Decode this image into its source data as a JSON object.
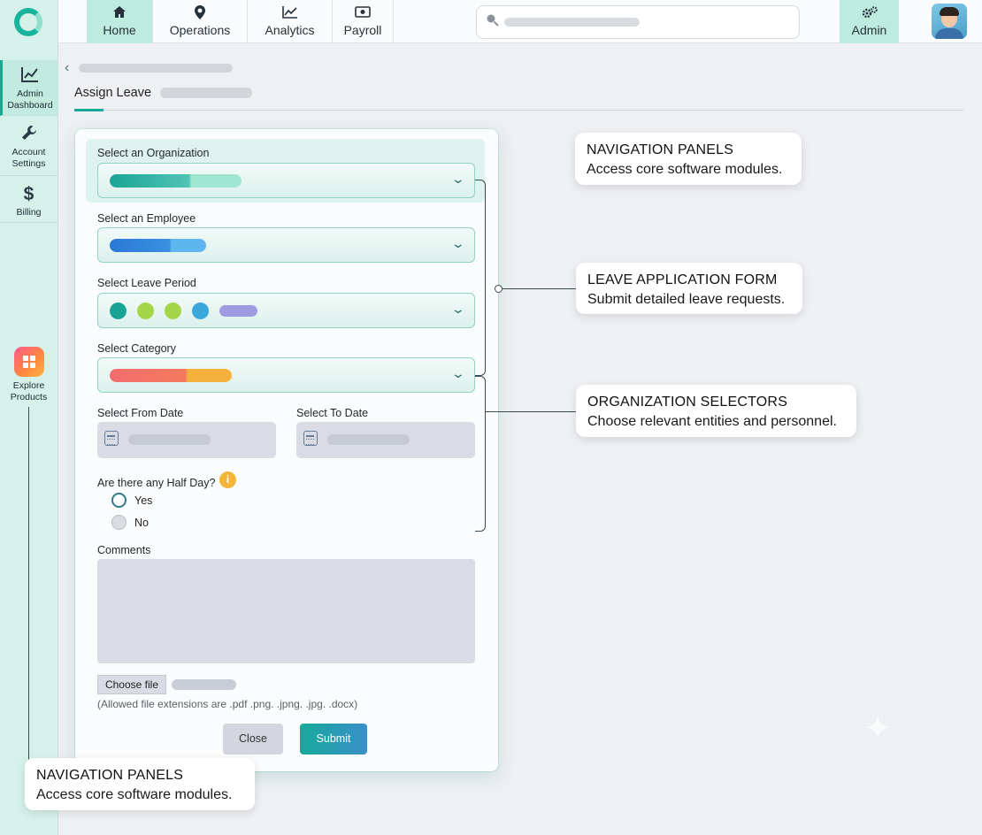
{
  "sidebar": {
    "items": [
      {
        "label1": "Admin",
        "label2": "Dashboard",
        "icon": "chart-line-icon"
      },
      {
        "label1": "Account",
        "label2": "Settings",
        "icon": "wrench-icon"
      },
      {
        "label1": "Billing",
        "label2": "",
        "icon": "dollar-icon"
      }
    ],
    "explore": {
      "label1": "Explore",
      "label2": "Products",
      "icon": "grid-apps-icon"
    }
  },
  "topnav": {
    "tabs": [
      {
        "label": "Home",
        "icon": "home-icon"
      },
      {
        "label": "Operations",
        "icon": "location-pin-icon"
      },
      {
        "label": "Analytics",
        "icon": "chart-line-icon"
      },
      {
        "label": "Payroll",
        "icon": "banknote-icon"
      }
    ],
    "admin_label": "Admin",
    "admin_icon": "gears-icon"
  },
  "header": {
    "title": "Assign Leave"
  },
  "form": {
    "organization_label": "Select an Organization",
    "employee_label": "Select an Employee",
    "period_label": "Select Leave Period",
    "category_label": "Select Category",
    "from_date_label": "Select From Date",
    "to_date_label": "Select To Date",
    "half_day_label": "Are there any Half Day?",
    "half_day_options": [
      "Yes",
      "No"
    ],
    "comments_label": "Comments",
    "choose_file_label": "Choose file",
    "file_hint": "(Allowed file extensions are .pdf  .png. .jpng. .jpg. .docx)",
    "close_label": "Close",
    "submit_label": "Submit"
  },
  "callouts": {
    "nav_top": {
      "title": "NAVIGATION PANELS",
      "desc": "Access core software modules."
    },
    "leave_form": {
      "title": "LEAVE APPLICATION FORM",
      "desc": "Submit detailed leave requests."
    },
    "org_selectors": {
      "title": "ORGANIZATION SELECTORS",
      "desc": "Choose relevant entities and personnel."
    },
    "nav_bottom": {
      "title": "NAVIGATION PANELS",
      "desc": "Access core software modules."
    }
  },
  "colors": {
    "accent": "#17a99a",
    "sidebar_bg": "#d5f1ea",
    "active_tab": "#bdebde",
    "submit_gradient_end": "#3a8fc9"
  }
}
